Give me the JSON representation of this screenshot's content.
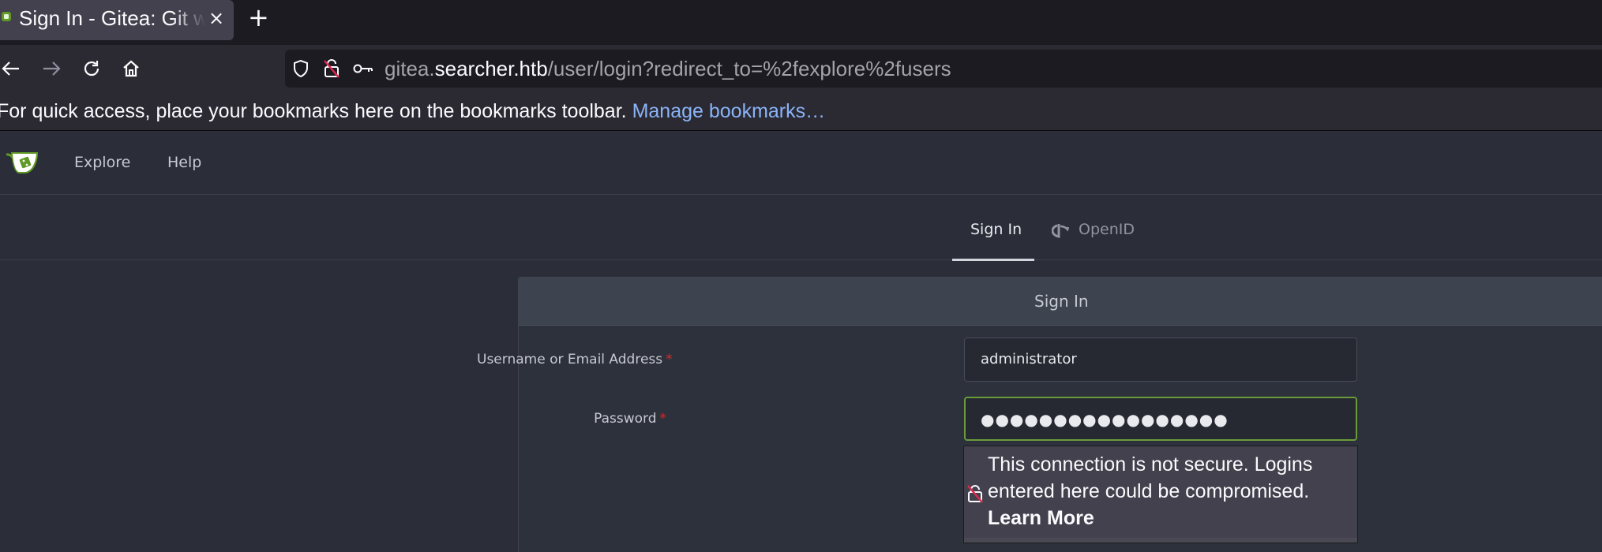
{
  "browser": {
    "tab": {
      "title": "Sign In - Gitea: Git with a cup of tea",
      "close_glyph": "×"
    },
    "new_tab_glyph": "+",
    "nav": {
      "back_icon": "arrow-left-icon",
      "forward_icon": "arrow-right-icon",
      "reload_icon": "reload-icon",
      "home_icon": "home-icon"
    },
    "url": {
      "prefix": "gitea.",
      "host": "searcher.htb",
      "path": "/user/login?redirect_to=%2fexplore%2fusers"
    },
    "bookmarks_bar": {
      "message": "For quick access, place your bookmarks here on the bookmarks toolbar. ",
      "link": "Manage bookmarks…"
    }
  },
  "gitea": {
    "nav": {
      "explore": "Explore",
      "help": "Help"
    },
    "tabs": {
      "sign_in": "Sign In",
      "openid": "OpenID"
    },
    "card": {
      "title": "Sign In",
      "username_label": "Username or Email Address",
      "username_value": "administrator",
      "password_label": "Password",
      "password_mask": "●●●●●●●●●●●●●●●●●",
      "required_mark": "*"
    },
    "insecure_warning": {
      "line1": "This connection is not secure. Logins",
      "line2": "entered here could be compromised.",
      "link": "Learn More"
    }
  },
  "colors": {
    "accent_green": "#609926",
    "focus_border": "#6a9a3a",
    "link_blue": "#8ab4f8",
    "required_red": "#db2828"
  }
}
